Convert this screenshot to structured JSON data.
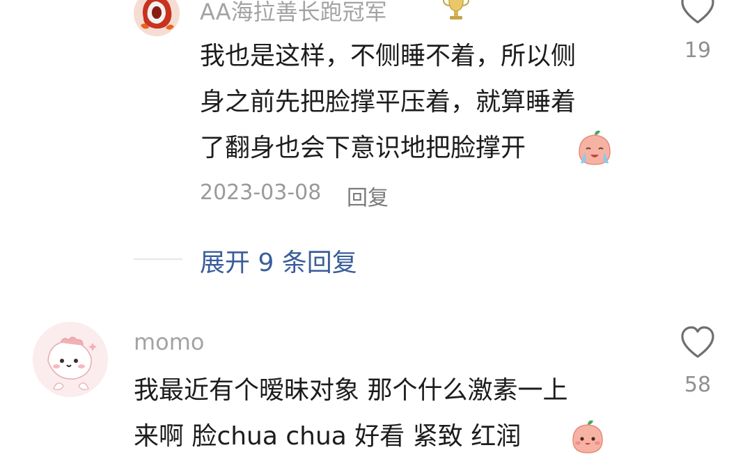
{
  "comment1": {
    "username": "AA海拉善长跑冠军",
    "badge": "trophy-icon",
    "lines": [
      "我也是这样，不侧睡不着，所以侧",
      "身之前先把脸撑平压着，就算睡着",
      "了翻身也会下意识地把脸撑开"
    ],
    "emoji": "crying-peach-emoji",
    "date": "2023-03-08",
    "reply_label": "回复",
    "like_count": "19",
    "expand_label": "展开 9 条回复"
  },
  "comment2": {
    "username": "momo",
    "lines": [
      "我最近有个暧昧对象 那个什么激素一上",
      "来啊 脸chua chua 好看 紧致 红润"
    ],
    "emoji": "smiling-peach-emoji",
    "like_count": "58"
  },
  "colors": {
    "username": "#a3a3a3",
    "text": "#1c1c1c",
    "link": "#3a5d9a",
    "muted": "#9a9a9a"
  }
}
